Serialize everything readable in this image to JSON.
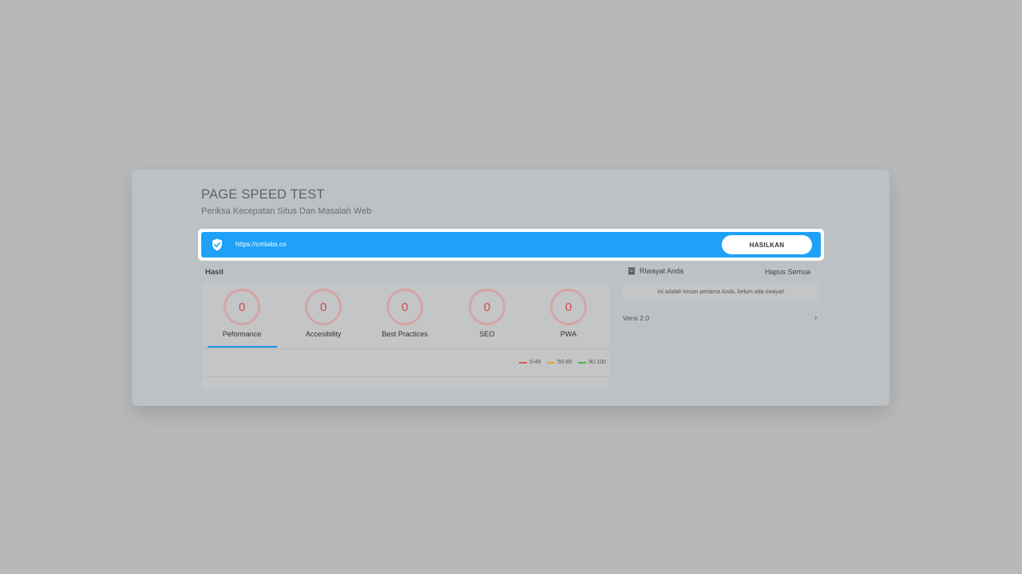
{
  "header": {
    "title": "PAGE SPEED TEST",
    "subtitle": "Periksa Kecepatan Situs Dan Masalah Web"
  },
  "url_bar": {
    "value": "https://cmlabs.co",
    "submit_label": "HASILKAN",
    "shield_icon": "shield-check-icon",
    "bar_color": "#1ea1f7"
  },
  "results": {
    "label": "Hasil",
    "scores": [
      {
        "label": "Peformance",
        "value": "0"
      },
      {
        "label": "Accesibility",
        "value": "0"
      },
      {
        "label": "Best Practices",
        "value": "0"
      },
      {
        "label": "SEO",
        "value": "0"
      },
      {
        "label": "PWA",
        "value": "0"
      }
    ],
    "active_tab": "Peformance",
    "legend": [
      {
        "label": "0-49",
        "color": "#e05656"
      },
      {
        "label": "50-89",
        "color": "#e0a830"
      },
      {
        "label": "90-100",
        "color": "#4caf50"
      }
    ]
  },
  "history": {
    "title": "Riwayat Anda",
    "clear_label": "Hapus Semua",
    "empty_message": "Ini adalah kesan pertama Anda, belum ada riwayat!",
    "icon": "archive-icon"
  },
  "footer": {
    "version": "Versi 2.0",
    "chevron_icon": "chevron-right-icon"
  }
}
